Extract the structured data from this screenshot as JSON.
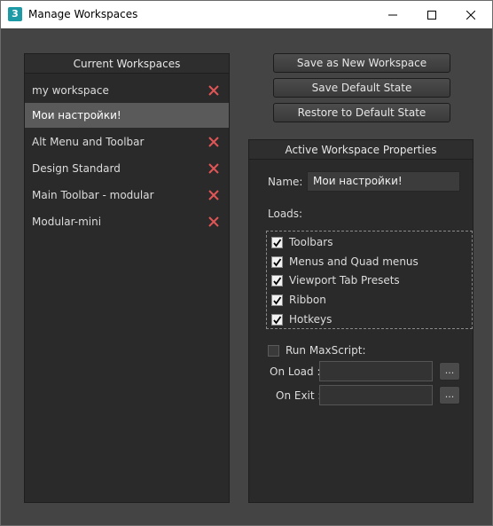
{
  "window": {
    "title": "Manage Workspaces",
    "app_icon_glyph": "3"
  },
  "workspaces": {
    "header": "Current Workspaces",
    "items": [
      {
        "label": "my workspace",
        "deletable": true
      },
      {
        "label": "Мои настройки!",
        "deletable": false,
        "selected": true
      },
      {
        "label": "Alt Menu and Toolbar",
        "deletable": true
      },
      {
        "label": "Design Standard",
        "deletable": true
      },
      {
        "label": "Main Toolbar - modular",
        "deletable": true
      },
      {
        "label": "Modular-mini",
        "deletable": true
      }
    ]
  },
  "actions": {
    "save_new": "Save as New Workspace",
    "save_default": "Save Default State",
    "restore_default": "Restore to Default State"
  },
  "properties": {
    "header": "Active Workspace Properties",
    "name_label": "Name:",
    "name_value": "Мои настройки!",
    "loads_label": "Loads:",
    "loads": [
      {
        "label": "Toolbars",
        "checked": true
      },
      {
        "label": "Menus and Quad menus",
        "checked": true
      },
      {
        "label": "Viewport Tab Presets",
        "checked": true
      },
      {
        "label": "Ribbon",
        "checked": true
      },
      {
        "label": "Hotkeys",
        "checked": true
      }
    ],
    "run_maxscript_label": "Run MaxScript:",
    "run_maxscript_checked": false,
    "on_load_label": "On Load :",
    "on_exit_label": "On Exit :",
    "browse_label": "..."
  },
  "colors": {
    "delete_icon": "#e05555",
    "selected_row": "#5a5a5a",
    "window_bg": "#444444"
  }
}
